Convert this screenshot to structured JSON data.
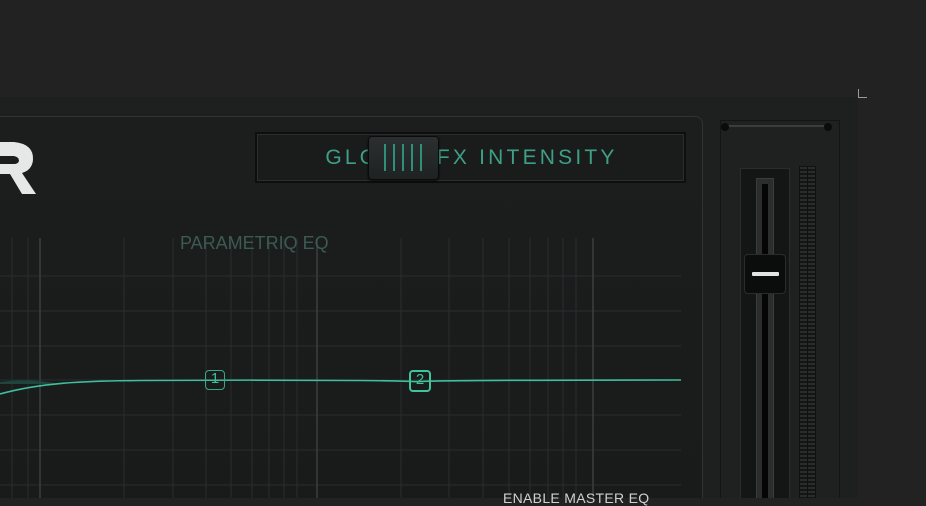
{
  "colors": {
    "accent": "#3fbf9b",
    "background": "#222222",
    "panel": "#1c1e1e"
  },
  "global_fx": {
    "label": "GLOBAL FX INTENSITY",
    "slider_icon": "grip-lines-icon"
  },
  "eq": {
    "title": "PARAMETRIQ EQ",
    "nodes": [
      {
        "label": "1"
      },
      {
        "label": "2"
      }
    ],
    "enable_master_label": "ENABLE MASTER EQ"
  },
  "fader": {
    "knob_icon": "fader-knob-icon"
  },
  "logo": {
    "icon": "logo-mark"
  }
}
